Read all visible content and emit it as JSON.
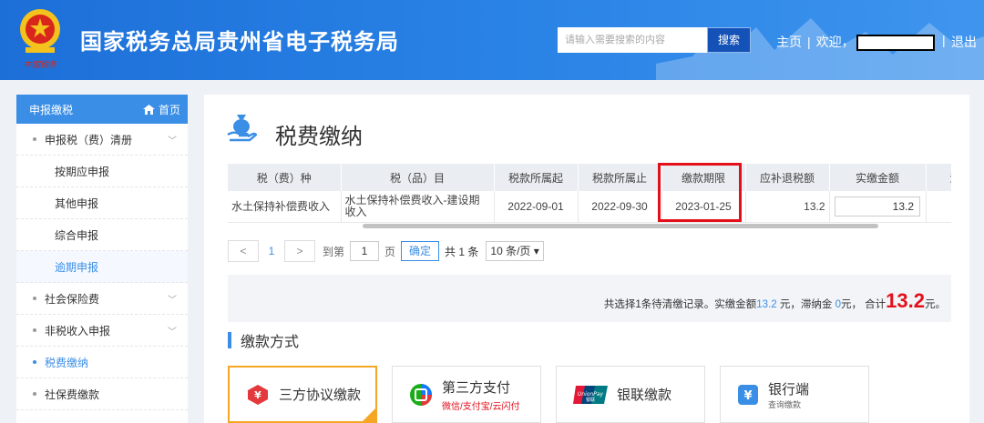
{
  "header": {
    "title": "国家税务总局贵州省电子税务局",
    "emblem_motto": "中国税务",
    "search_placeholder": "请输入需要搜索的内容",
    "search_button": "搜索",
    "home_link": "主页",
    "welcome": "欢迎，",
    "logout": "退出"
  },
  "sidebar": {
    "header_label": "申报缴税",
    "home_label": "首页",
    "items": [
      {
        "label": "申报税（费）清册",
        "type": "group",
        "expandable": true
      },
      {
        "label": "按期应申报",
        "type": "sub"
      },
      {
        "label": "其他申报",
        "type": "sub"
      },
      {
        "label": "综合申报",
        "type": "sub"
      },
      {
        "label": "逾期申报",
        "type": "sub",
        "active": true
      },
      {
        "label": "社会保险费",
        "type": "group",
        "expandable": true
      },
      {
        "label": "非税收入申报",
        "type": "group",
        "expandable": true
      },
      {
        "label": "税费缴纳",
        "type": "group",
        "active": true
      },
      {
        "label": "社保费缴款",
        "type": "group"
      }
    ]
  },
  "main": {
    "title": "税费缴纳",
    "table": {
      "headers": [
        "税（费）种",
        "税（品）目",
        "税款所属起",
        "税款所属止",
        "缴款期限",
        "应补退税额",
        "实缴金额",
        "滞"
      ],
      "rows": [
        {
          "tax_type": "水土保持补偿费收入",
          "item": "水土保持补偿费收入-建设期收入",
          "period_start": "2022-09-01",
          "period_end": "2022-09-30",
          "deadline": "2023-01-25",
          "due_amount": "13.2",
          "paid_amount": "13.2"
        }
      ]
    },
    "pager": {
      "prev": "<",
      "current_page": "1",
      "next": ">",
      "goto_label": "到第",
      "goto_value": "1",
      "page_unit": "页",
      "confirm": "确定",
      "total": "共 1 条",
      "page_size": "10 条/页"
    },
    "summary": {
      "text1": "共选择1条待清缴记录。实缴金额",
      "paid": "13.2",
      "text2": " 元，滞纳金 ",
      "late_fee": "0",
      "text3": "元， 合计",
      "total": "13.2",
      "text4": "元。"
    },
    "payment_section_title": "缴款方式",
    "payment_methods": [
      {
        "label": "三方协议缴款",
        "sub": "",
        "active": true
      },
      {
        "label": "第三方支付",
        "sub": "微信/支付宝/云闪付"
      },
      {
        "label": "银联缴款",
        "sub": ""
      },
      {
        "label": "银行端",
        "sub": "查询缴款"
      }
    ]
  },
  "colors": {
    "header_blue": "#2a84e6",
    "accent_blue": "#3a8ee6",
    "highlight_red": "#e30f1b",
    "active_orange": "#f5a623"
  }
}
